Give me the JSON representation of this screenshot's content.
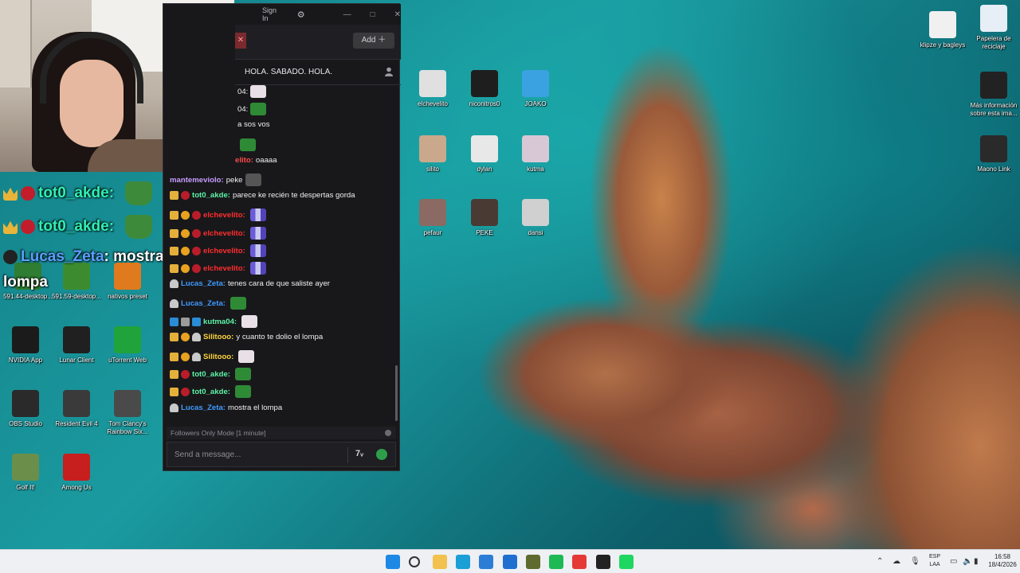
{
  "overlay": {
    "lines": [
      {
        "name": "tot0_akde:",
        "text": ""
      },
      {
        "name": "tot0_akde:",
        "text": ""
      },
      {
        "name": "Lucas_Zeta",
        "text": ": mostra el"
      },
      {
        "name": "",
        "text": "lompa"
      }
    ]
  },
  "desktop_left": [
    {
      "label": "591.44-desktop...",
      "icon": "nvidia-installer-icon",
      "color": "#2e7d32"
    },
    {
      "label": "591.59-desktop...",
      "icon": "nvidia-installer-icon",
      "color": "#3c8c2f"
    },
    {
      "label": "nativos preset",
      "icon": "fl-studio-icon",
      "color": "#e07a1f"
    },
    {
      "label": "NVIDIA App",
      "icon": "nvidia-icon",
      "color": "#1b1b1b"
    },
    {
      "label": "Lunar Client",
      "icon": "lunar-client-icon",
      "color": "#202020"
    },
    {
      "label": "uTorrent Web",
      "icon": "utorrent-icon",
      "color": "#1fa33a"
    },
    {
      "label": "OBS Studio",
      "icon": "obs-icon",
      "color": "#2a2a2a"
    },
    {
      "label": "Resident Evil 4",
      "icon": "re4-icon",
      "color": "#3a3a3a"
    },
    {
      "label": "Tom Clancy's Rainbow Six...",
      "icon": "rainbow-six-icon",
      "color": "#4a4a4a"
    },
    {
      "label": "Golf It!",
      "icon": "golf-it-icon",
      "color": "#6b8f4a"
    },
    {
      "label": "Among Us",
      "icon": "among-us-icon",
      "color": "#c71e1e"
    }
  ],
  "desktop_mid": [
    {
      "label": "elchevelito",
      "icon": "folder-cat-icon",
      "color": "#e0e0e0"
    },
    {
      "label": "niconitros0",
      "icon": "folder-dark-icon",
      "color": "#1e1e1e"
    },
    {
      "label": "JOAKO",
      "icon": "stumble-guys-icon",
      "color": "#3aa2e0"
    },
    {
      "label": "silito",
      "icon": "folder-cat-icon",
      "color": "#caa88c"
    },
    {
      "label": "dylan",
      "icon": "folder-cat-icon",
      "color": "#e8e8e8"
    },
    {
      "label": "kutma",
      "icon": "folder-cat-icon",
      "color": "#d8c8d6"
    },
    {
      "label": "pefaur",
      "icon": "folder-girl-icon",
      "color": "#8a6a62"
    },
    {
      "label": "PEKE",
      "icon": "folder-man-icon",
      "color": "#4a3a34"
    },
    {
      "label": "dansi",
      "icon": "folder-panda-icon",
      "color": "#d0d0d0"
    }
  ],
  "desktop_right": [
    {
      "label": "klipze y bagleys",
      "icon": "folder-image-icon",
      "color": "#f0f0f0"
    },
    {
      "label": "Papelera de reciclaje",
      "icon": "recycle-bin-icon",
      "color": "#e6eef6"
    },
    {
      "label": "Más información sobre esta ima...",
      "icon": "info-icon",
      "color": "#222"
    },
    {
      "label": "Maono Link",
      "icon": "maono-link-icon",
      "color": "#2a2a2a"
    }
  ],
  "chat": {
    "titlebar": {
      "signin": "Sign In",
      "add": "Add ＋",
      "close_tab": "✕"
    },
    "room_title": "HOLA. SABADO. HOLA.",
    "messages": [
      {
        "badges": [],
        "name": "",
        "name_color": "#efeff1",
        "text": "04:",
        "emote": "cat"
      },
      {
        "badges": [],
        "name": "",
        "name_color": "#efeff1",
        "text": "04:",
        "emote": "frog"
      },
      {
        "badges": [],
        "name": "",
        "name_color": "#efeff1",
        "text": "a sos vos",
        "emote": ""
      },
      {
        "badges": [],
        "name": "",
        "name_color": "#efeff1",
        "text": "",
        "emote": "frog"
      },
      {
        "badges": [],
        "name": "elito:",
        "name_color": "#ff4a4a",
        "text": "oaaaa",
        "emote": ""
      },
      {
        "badges": [],
        "name": "mantemeviolo:",
        "name_color": "#c89cff",
        "text": "peke",
        "emote": "dark"
      },
      {
        "badges": [
          "crown",
          "red"
        ],
        "name": "tot0_akde:",
        "name_color": "#5cf5a6",
        "text": "parece ke recién te despertas gorda",
        "emote": ""
      },
      {
        "badges": [
          "crown",
          "one",
          "red"
        ],
        "name": "elchevelito:",
        "name_color": "#ff2d2d",
        "text": "",
        "emote": "pixel"
      },
      {
        "badges": [
          "crown",
          "one",
          "red"
        ],
        "name": "elchevelito:",
        "name_color": "#ff2d2d",
        "text": "",
        "emote": "pixel"
      },
      {
        "badges": [
          "crown",
          "one",
          "red"
        ],
        "name": "elchevelito:",
        "name_color": "#ff2d2d",
        "text": "",
        "emote": "pixel"
      },
      {
        "badges": [
          "crown",
          "one",
          "red"
        ],
        "name": "elchevelito:",
        "name_color": "#ff2d2d",
        "text": "",
        "emote": "pixel"
      },
      {
        "badges": [
          "hat"
        ],
        "name": "Lucas_Zeta:",
        "name_color": "#3f9bff",
        "text": "tenes cara de que saliste ayer",
        "emote": ""
      },
      {
        "badges": [
          "hat"
        ],
        "name": "Lucas_Zeta:",
        "name_color": "#3f9bff",
        "text": "",
        "emote": "frog"
      },
      {
        "badges": [
          "blue",
          "gray",
          "blue"
        ],
        "name": "kutma04:",
        "name_color": "#5cf5a6",
        "text": "",
        "emote": "cat"
      },
      {
        "badges": [
          "crown",
          "one",
          "hat"
        ],
        "name": "Silitooo:",
        "name_color": "#ffd43a",
        "text": "y cuanto te dolio el lompa",
        "emote": ""
      },
      {
        "badges": [
          "crown",
          "one",
          "hat"
        ],
        "name": "Silitooo:",
        "name_color": "#ffd43a",
        "text": "",
        "emote": "cat"
      },
      {
        "badges": [
          "crown",
          "red"
        ],
        "name": "tot0_akde:",
        "name_color": "#5cf5a6",
        "text": "",
        "emote": "frog"
      },
      {
        "badges": [
          "crown",
          "red"
        ],
        "name": "tot0_akde:",
        "name_color": "#5cf5a6",
        "text": "",
        "emote": "frog"
      },
      {
        "badges": [
          "hat"
        ],
        "name": "Lucas_Zeta:",
        "name_color": "#3f9bff",
        "text": "mostra el lompa",
        "emote": ""
      }
    ],
    "followers_mode": "Followers Only Mode [1 minute]",
    "input_placeholder": "Send a message..."
  },
  "taskbar": {
    "lang_1": "ESP",
    "lang_2": "LAA",
    "time": "16:58",
    "date": "18/4/2026",
    "apps": [
      "windows-start-icon",
      "search-icon",
      "file-explorer-icon",
      "edge-icon",
      "microsoft-store-icon",
      "outlook-icon",
      "game-icon",
      "spotify-icon",
      "chrome-icon",
      "obs-taskbar-icon",
      "chatterino-icon"
    ]
  }
}
